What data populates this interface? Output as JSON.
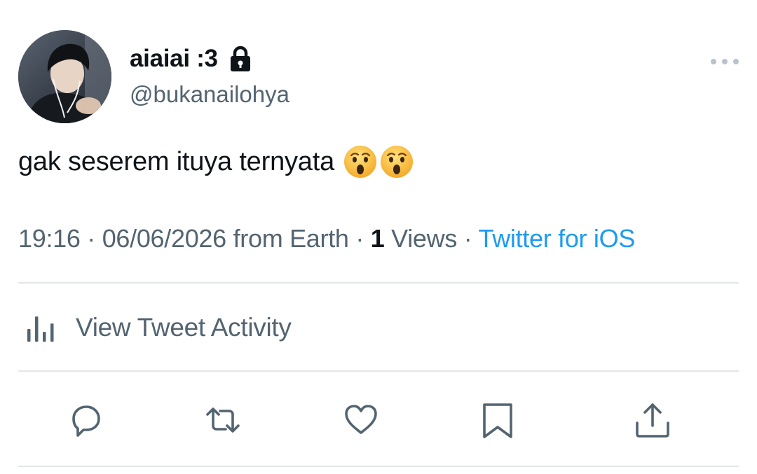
{
  "author": {
    "display_name": "aiaiai :3",
    "handle": "@bukanailohya",
    "protected_icon": "lock-icon"
  },
  "tweet": {
    "text": "gak seserem ituya ternyata",
    "emojis": [
      "hushed-face",
      "hushed-face"
    ]
  },
  "meta": {
    "time": "19:16",
    "sep1": " · ",
    "date": "06/06/2026",
    "location": " from Earth",
    "sep2": " · ",
    "views_count": "1",
    "views_label": " Views",
    "sep3": " · ",
    "source": "Twitter for iOS"
  },
  "activity": {
    "label": "View Tweet Activity",
    "icon": "bar-chart-icon"
  },
  "actions": {
    "reply": "reply-icon",
    "retweet": "retweet-icon",
    "like": "heart-icon",
    "bookmark": "bookmark-icon",
    "share": "share-icon"
  },
  "colors": {
    "text_primary": "#0f1419",
    "text_secondary": "#536471",
    "link": "#1d9bf0",
    "divider": "#e3e6e9"
  }
}
